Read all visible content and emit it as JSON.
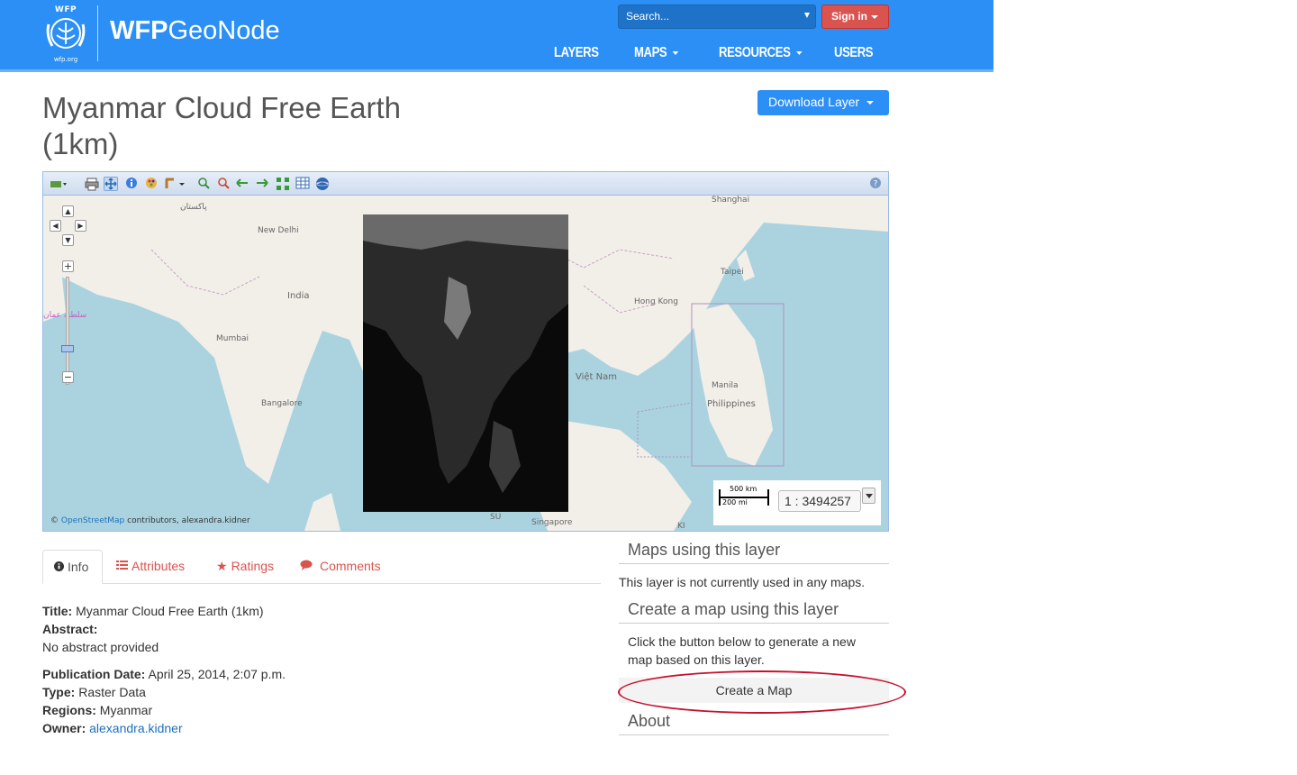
{
  "header": {
    "logo_top": "WFP",
    "logo_bottom": "wfp.org",
    "brand_bold": "WFP",
    "brand_rest": "GeoNode",
    "search_placeholder": "Search...",
    "signin_label": "Sign in",
    "nav": [
      {
        "label": "LAYERS"
      },
      {
        "label": "MAPS"
      },
      {
        "label": "RESOURCES"
      },
      {
        "label": "USERS"
      }
    ]
  },
  "page": {
    "title_line1": "Myanmar Cloud Free Earth",
    "title_line2": "(1km)",
    "download_label": "Download Layer"
  },
  "map": {
    "scale_km": "500 km",
    "scale_mi": "200 mi",
    "scale_value": "1 : 3494257",
    "attribution_prefix": "© ",
    "attribution_link": "OpenStreetMap",
    "attribution_suffix": " contributors, alexandra.kidner",
    "labels": {
      "india": "India",
      "new_delhi": "New Delhi",
      "mumbai": "Mumbai",
      "bangalore": "Bangalore",
      "hong_kong": "Hong Kong",
      "viet_nam": "Việt Nam",
      "manila": "Manila",
      "philippines": "Philippines",
      "singapore": "Singapore",
      "shanghai": "Shanghai",
      "taipei": "Taipei",
      "pakistan": "پاکستان",
      "oman": "سلطنة عمان",
      "su": "SU",
      "ki": "KI"
    }
  },
  "tabs": [
    {
      "label": "Info",
      "icon": "info-icon"
    },
    {
      "label": "Attributes",
      "icon": "list-icon"
    },
    {
      "label": "Ratings",
      "icon": "star-icon"
    },
    {
      "label": "Comments",
      "icon": "comment-icon"
    }
  ],
  "info": {
    "title_label": "Title:",
    "title_value": "Myanmar Cloud Free Earth (1km)",
    "abstract_label": "Abstract:",
    "abstract_value": "No abstract provided",
    "pubdate_label": "Publication Date:",
    "pubdate_value": "April 25, 2014, 2:07 p.m.",
    "type_label": "Type:",
    "type_value": "Raster Data",
    "regions_label": "Regions:",
    "regions_value": "Myanmar",
    "owner_label": "Owner:",
    "owner_value": "alexandra.kidner"
  },
  "sidebar": {
    "maps_heading": "Maps using this layer",
    "maps_text": "This layer is not currently used in any maps.",
    "create_heading": "Create a map using this layer",
    "create_text": "Click the button below to generate a new map based on this layer.",
    "create_button": "Create a Map",
    "about_heading": "About"
  },
  "colors": {
    "navbar": "#2b8ff5",
    "signin": "#d9534f",
    "tab_link": "#d9534f",
    "highlight": "#c8102e"
  }
}
